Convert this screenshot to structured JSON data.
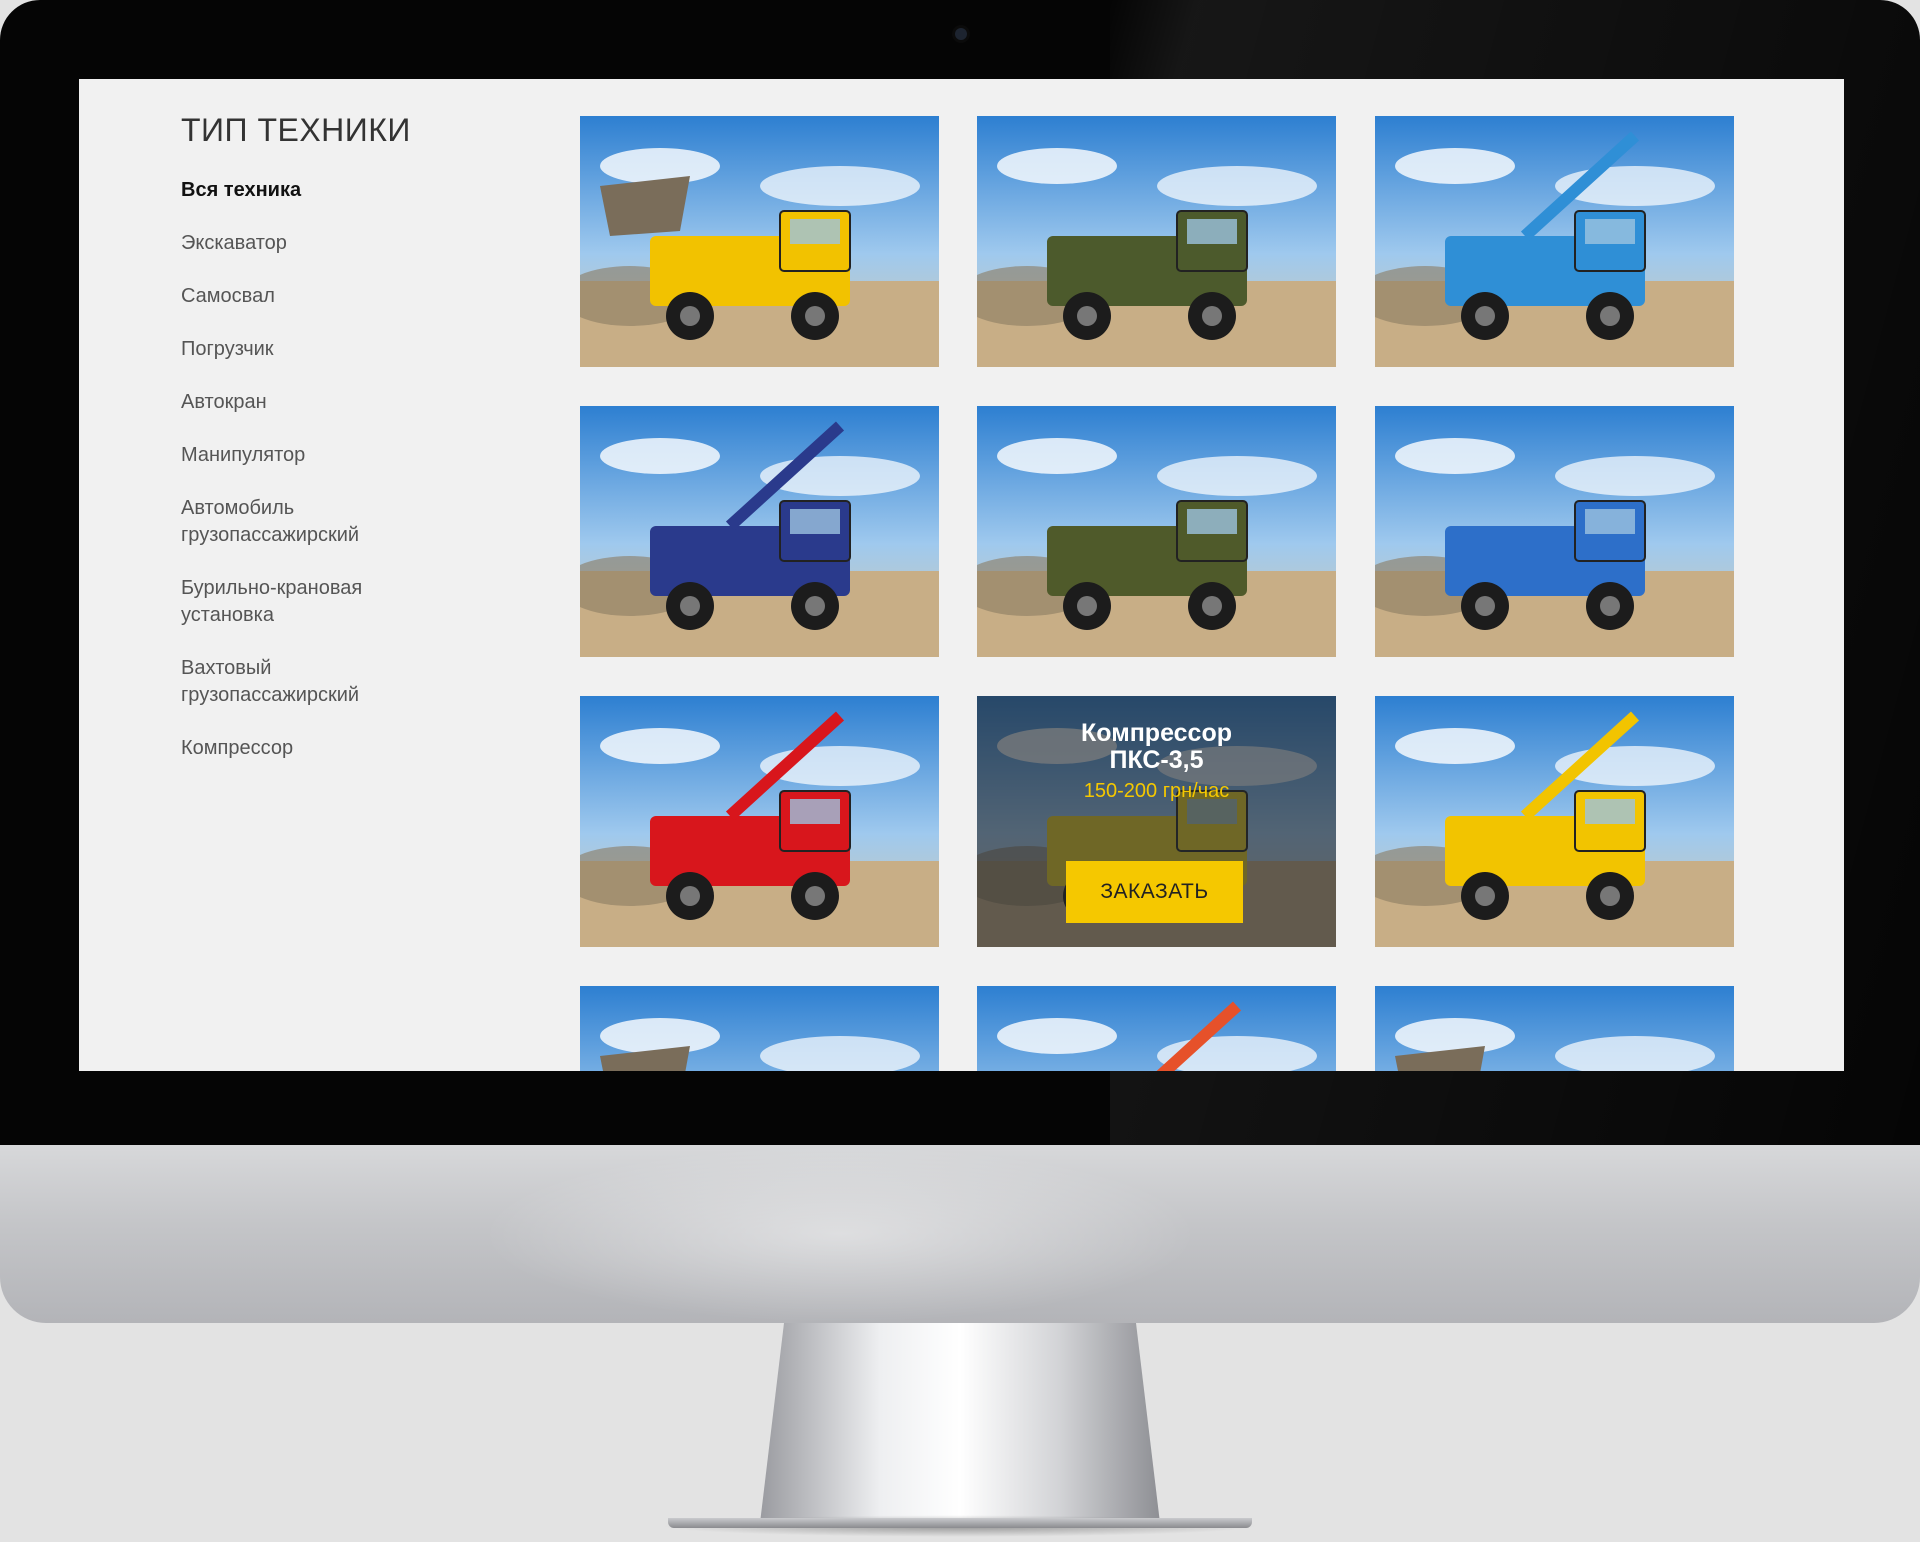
{
  "sidebar": {
    "title": "ТИП ТЕХНИКИ",
    "items": [
      {
        "label": "Вся техника",
        "active": true
      },
      {
        "label": "Экскаватор"
      },
      {
        "label": "Самосвал"
      },
      {
        "label": "Погрузчик"
      },
      {
        "label": "Автокран"
      },
      {
        "label": "Манипулятор"
      },
      {
        "label": "Автомобиль\nгрузопассажирский"
      },
      {
        "label": "Бурильно-крановая\nустановка"
      },
      {
        "label": "Вахтовый\nгрузопассажирский"
      },
      {
        "label": "Компрессор"
      }
    ]
  },
  "promo": {
    "title": "Компрессор\nПКС-3,5",
    "price": "150-200 грн/час",
    "button_label": "ЗАКАЗАТЬ"
  },
  "gallery": [
    {
      "icon": "backhoe-loader-photo",
      "body_color": "#f2c200"
    },
    {
      "icon": "military-truck-photo",
      "body_color": "#4c5a2c"
    },
    {
      "icon": "truck-crane-photo",
      "body_color": "#2f8fd6"
    },
    {
      "icon": "drilling-rig-photo",
      "body_color": "#2a3a8c"
    },
    {
      "icon": "dump-truck-photo",
      "body_color": "#4f5a2a"
    },
    {
      "icon": "flatbed-truck-photo",
      "body_color": "#2d6fc9"
    },
    {
      "icon": "manipulator-truck-photo",
      "body_color": "#d8161c"
    },
    {
      "icon": "compressor-promo",
      "body_color": "#e9cf20"
    },
    {
      "icon": "yellow-crane-photo",
      "body_color": "#f2c400"
    },
    {
      "icon": "excavator-photo",
      "body_color": "#c43520"
    },
    {
      "icon": "crane-photo",
      "body_color": "#e6512a"
    },
    {
      "icon": "excavator-photo",
      "body_color": "#d52a20"
    }
  ],
  "colors": {
    "accent": "#f5c800",
    "page_background": "#f1f1f1"
  }
}
